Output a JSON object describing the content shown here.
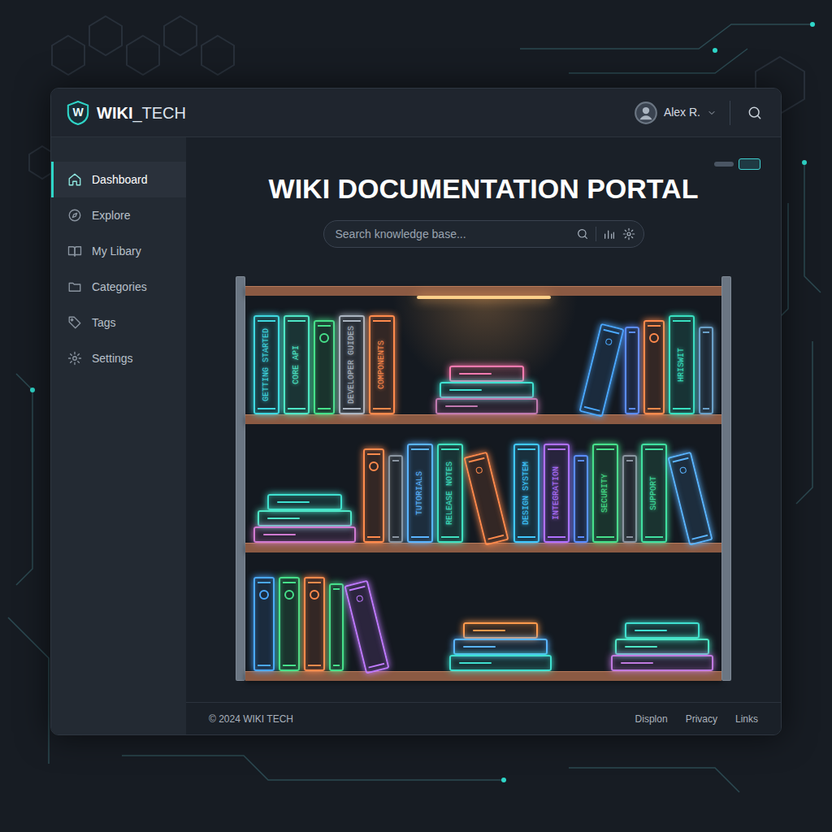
{
  "header": {
    "logo_mark": "W",
    "logo_bold": "WIKI",
    "logo_rest": "_TECH",
    "user": "Alex R."
  },
  "sidebar": {
    "items": [
      {
        "label": "Dashboard",
        "selected": true
      },
      {
        "label": "Explore",
        "selected": false
      },
      {
        "label": "My Libary",
        "selected": false
      },
      {
        "label": "Categories",
        "selected": false
      },
      {
        "label": "Tags",
        "selected": false
      },
      {
        "label": "Settings",
        "selected": false
      }
    ]
  },
  "main": {
    "title": "WIKI DOCUMENTATION PORTAL"
  },
  "search": {
    "placeholder": "Search knowledge base..."
  },
  "shelves": [
    {
      "groups": [
        {
          "books": [
            {
              "kind": "spine",
              "label": "GETTING STARTED",
              "color": "#3fd8e0"
            },
            {
              "kind": "spine",
              "label": "CORE API",
              "color": "#4ee6c6"
            },
            {
              "kind": "emblem",
              "color": "#46e08a"
            },
            {
              "kind": "spine",
              "label": "DEVELOPER GUIDES",
              "color": "#aab4c0"
            },
            {
              "kind": "spine",
              "label": "COMPONENTS",
              "color": "#ff8a4c"
            }
          ]
        },
        {
          "books": [
            {
              "kind": "stack",
              "colors": [
                "#ff7ab0",
                "#3fe0d0",
                "#c07ab0"
              ]
            }
          ]
        },
        {
          "books": [
            {
              "kind": "tilted",
              "lean": "right",
              "color": "#4aa8ff"
            },
            {
              "kind": "slim",
              "color": "#5a8cff"
            },
            {
              "kind": "emblem",
              "color": "#ff8a4c"
            },
            {
              "kind": "spine",
              "label": "HRISWIT",
              "color": "#38e0c0"
            },
            {
              "kind": "slim",
              "color": "#6aa0c8"
            }
          ]
        }
      ]
    },
    {
      "groups": [
        {
          "books": [
            {
              "kind": "stack",
              "colors": [
                "#3fe0d0",
                "#4ee6c6",
                "#d07ad0"
              ]
            }
          ]
        },
        {
          "books": [
            {
              "kind": "emblem",
              "color": "#ff8a4c"
            },
            {
              "kind": "slim",
              "color": "#8a94a0"
            },
            {
              "kind": "spine",
              "label": "TUTORIALS",
              "color": "#5ab4ff"
            },
            {
              "kind": "spine",
              "label": "RELEASE NOTES",
              "color": "#3fe0c0"
            },
            {
              "kind": "tilted",
              "lean": "left",
              "color": "#ff8a4c"
            },
            {
              "kind": "spine",
              "label": "DESIGN SYSTEM",
              "color": "#3fc8ff"
            },
            {
              "kind": "spine",
              "label": "INTEGRATION",
              "color": "#b070ff"
            },
            {
              "kind": "slim",
              "color": "#5a8cff"
            },
            {
              "kind": "spine",
              "label": "SECURITY",
              "color": "#46e08a"
            },
            {
              "kind": "slim",
              "color": "#8a94a0"
            },
            {
              "kind": "spine",
              "label": "SUPPORT",
              "color": "#40e0a0"
            },
            {
              "kind": "tilted",
              "lean": "left",
              "color": "#5ab4ff"
            }
          ]
        }
      ]
    },
    {
      "groups": [
        {
          "books": [
            {
              "kind": "emblem",
              "color": "#4aa8ff"
            },
            {
              "kind": "emblem",
              "color": "#46e08a"
            },
            {
              "kind": "emblem",
              "color": "#ff8a4c"
            },
            {
              "kind": "slim",
              "color": "#46e08a"
            },
            {
              "kind": "tilted",
              "lean": "left",
              "color": "#c07aff"
            }
          ]
        },
        {
          "books": [
            {
              "kind": "stack",
              "colors": [
                "#ff9a4c",
                "#5ab4ff",
                "#3fe0d0"
              ]
            }
          ]
        },
        {
          "books": [
            {
              "kind": "stack",
              "colors": [
                "#3fe0d0",
                "#4ee6c6",
                "#c07ae0"
              ]
            }
          ]
        }
      ]
    }
  ],
  "footer": {
    "copyright": "© 2024 WIKI TECH",
    "links": [
      "Displon",
      "Privacy",
      "Links"
    ]
  }
}
